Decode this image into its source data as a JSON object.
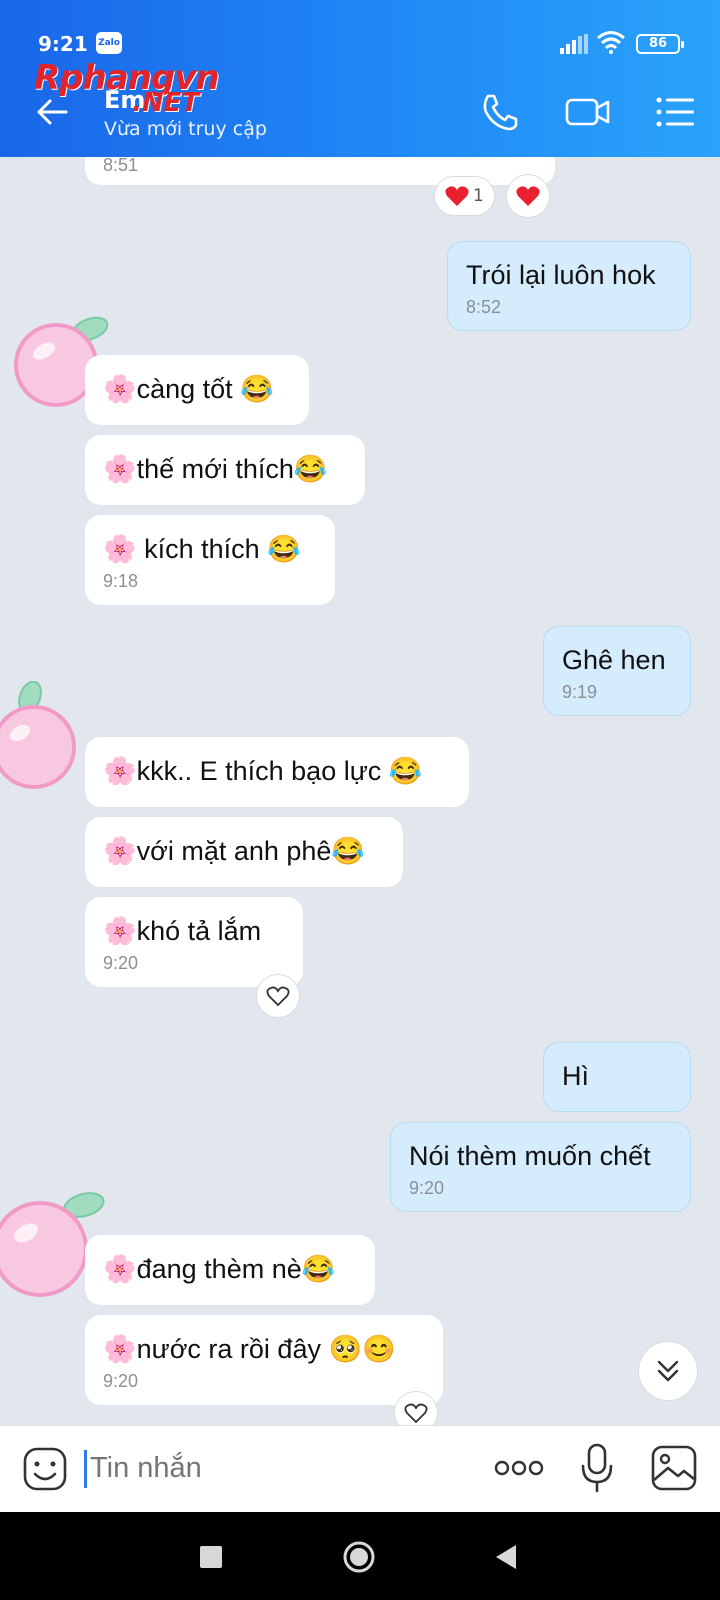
{
  "status_bar": {
    "time": "9:21",
    "app_badge": "Zalo",
    "battery": "86"
  },
  "header": {
    "contact_name": "Em",
    "contact_status": "Vừa mới truy cập",
    "watermark_main": "Rphangvn",
    "watermark_sub": ".NET",
    "icons": [
      "back-arrow-icon",
      "phone-icon",
      "video-call-icon",
      "menu-list-icon"
    ]
  },
  "messages": [
    {
      "side": "received",
      "text": "",
      "time": "8:51"
    },
    {
      "side": "sent",
      "text": "Trói lại luôn hok",
      "time": "8:52"
    },
    {
      "side": "received",
      "text": "🌸càng tốt 😂"
    },
    {
      "side": "received",
      "text": "🌸thế mới thích😂"
    },
    {
      "side": "received",
      "text": "🌸 kích thích 😂",
      "time": "9:18"
    },
    {
      "side": "sent",
      "text": "Ghê hen",
      "time": "9:19"
    },
    {
      "side": "received",
      "text": "🌸kkk.. E thích bạo lực 😂"
    },
    {
      "side": "received",
      "text": "🌸với mặt anh phê😂"
    },
    {
      "side": "received",
      "text": "🌸khó tả lắm",
      "time": "9:20"
    },
    {
      "side": "sent",
      "text": "Hì"
    },
    {
      "side": "sent",
      "text": "Nói thèm muốn chết",
      "time": "9:20"
    },
    {
      "side": "received",
      "text": "🌸đang thèm nè😂"
    },
    {
      "side": "received",
      "text": "🌸nước ra rồi đây 🥺😊",
      "time": "9:20"
    }
  ],
  "reactions": {
    "heart_count": "1"
  },
  "input": {
    "placeholder": "Tin nhắn"
  },
  "colors": {
    "header_start": "#1a66e8",
    "header_end": "#2aa3fb",
    "sent_bubble": "#d5ecfd",
    "received_bubble": "#ffffff",
    "background": "#e2e6ed"
  }
}
